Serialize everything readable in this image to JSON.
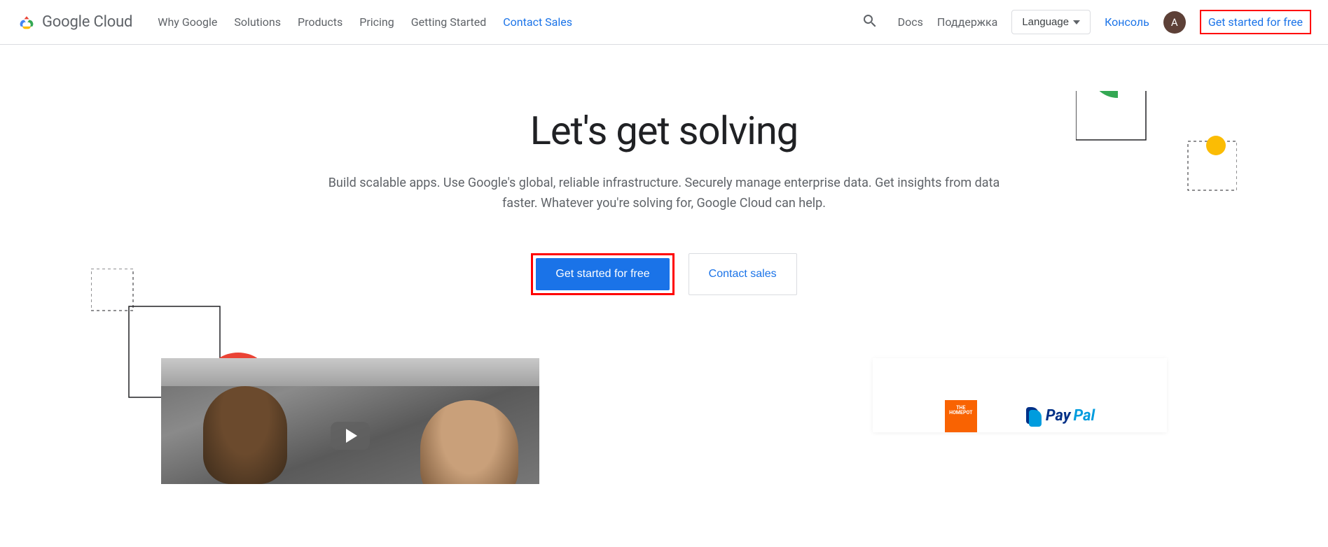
{
  "brand": "Google Cloud",
  "nav": {
    "why": "Why Google",
    "solutions": "Solutions",
    "products": "Products",
    "pricing": "Pricing",
    "getting_started": "Getting Started",
    "contact_sales": "Contact Sales"
  },
  "topright": {
    "docs": "Docs",
    "support": "Поддержка",
    "language": "Language",
    "console": "Консоль",
    "avatar_initial": "A",
    "get_started": "Get started for free"
  },
  "hero": {
    "title": "Let's get solving",
    "subtitle": "Build scalable apps. Use Google's global, reliable infrastructure. Securely manage enterprise data. Get insights from data faster. Whatever you're solving for, Google Cloud can help.",
    "primary_cta": "Get started for free",
    "secondary_cta": "Contact sales"
  },
  "logos": {
    "paypal": "PayPal"
  }
}
